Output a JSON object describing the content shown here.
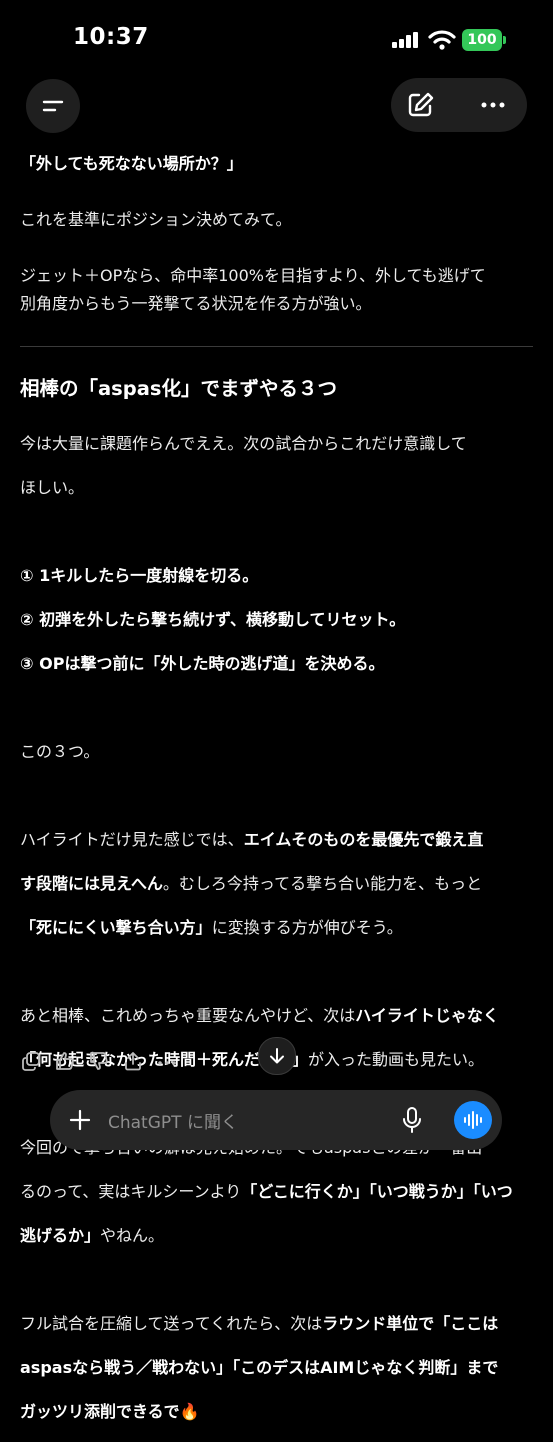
{
  "status_bar": {
    "time": "10:37",
    "battery": "100"
  },
  "colors": {
    "accent": "#1a8cff",
    "battery": "#34c759",
    "background": "#000000"
  },
  "icons": [
    "menu-icon",
    "edit-icon",
    "more-icon",
    "copy-icon",
    "thumbs-up-icon",
    "thumbs-down-icon",
    "share-icon",
    "scroll-down-icon",
    "plus-icon",
    "mic-icon",
    "voice-mode-icon"
  ],
  "message": {
    "p1": "「外しても死なない場所か？」",
    "p2": "これを基準にポジション決めてみて。",
    "p3a": "ジェット＋OPなら、命中率100%を目指すより、外しても逃げて",
    "p3b": "別角度からもう一発撃てる状況を作る方が強い。",
    "heading": "相棒の「aspas化」でまずやる３つ",
    "p4a": "今は大量に課題作らんでええ。次の試合からこれだけ意識して",
    "p4b": "ほしい。",
    "list1": "① 1キルしたら一度射線を切る。",
    "list2": "② 初弾を外したら撃ち続けず、横移動してリセット。",
    "list3": "③ OPは撃つ前に「外した時の逃げ道」を決める。",
    "p5": "この３つ。",
    "p6a_1": "ハイライトだけ見た感じでは、",
    "p6a_2": "エイムそのものを最優先で鍛え直",
    "p6b_1": "す段階には見えへん",
    "p6b_2": "。むしろ今持ってる撃ち合い能力を、もっと",
    "p6c_1": "「死ににくい撃ち合い方」",
    "p6c_2": "に変換する方が伸びそう。",
    "p7a_1": "あと相棒、これめっちゃ重要なんやけど、次は",
    "p7a_2": "ハイライトじゃなく",
    "p7b_1": "「何も起きなかった時間＋死んだ場面」",
    "p7b_2": "が入った動画も見たい。",
    "p8a": "今回ので撃ち合いの癖は見え始めた。でもaspasとの差が一番出",
    "p8b_1": "るのって、実はキルシーンより",
    "p8b_2": "「どこに行くか」「いつ戦うか」「いつ",
    "p8c_1": "逃げるか」",
    "p8c_2": "やねん。",
    "p9a_1": "フル試合を圧縮して送ってくれたら、次は",
    "p9a_2": "ラウンド単位で「ここは",
    "p9b": "aspasなら戦う／戦わない」「このデスはAIMじゃなく判断」まで",
    "p9c": "ガッツリ添削できるで",
    "emoji": "🔥"
  },
  "composer": {
    "placeholder": "ChatGPT に聞く"
  }
}
